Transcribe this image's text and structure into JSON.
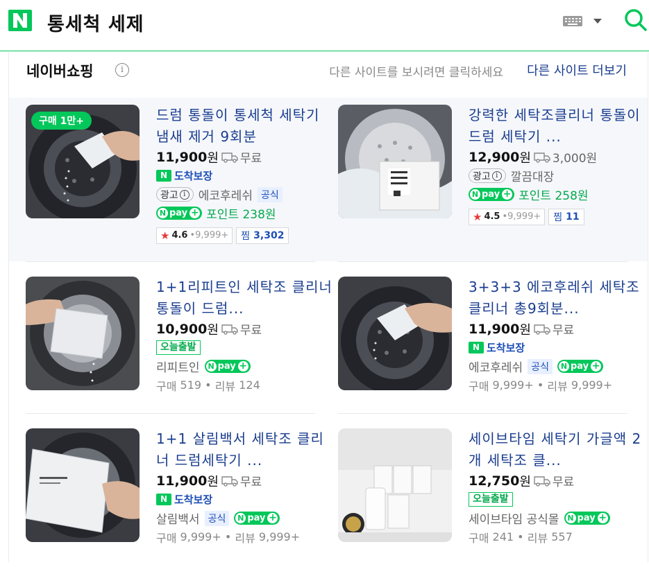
{
  "header": {
    "query": "통세척 세제"
  },
  "section": {
    "title": "네이버쇼핑",
    "other_hint": "다른 사이트를 보시려면 클릭하세요",
    "other_link": "다른 사이트 더보기"
  },
  "labels": {
    "won": "원",
    "ad": "광고",
    "official": "공식",
    "arrival": "도착보장",
    "today": "오늘출발",
    "npay": "pay",
    "zzim": "찜",
    "points_prefix": "포인트",
    "purchase": "구매",
    "review": "리뷰",
    "star": "★"
  },
  "products": [
    {
      "title": "드럼 통돌이 통세척 세탁기 냄새 제거 9회분",
      "price": "11,900",
      "shipping": "무료",
      "badge": "구매 1만+",
      "seller": "에코후레쉬",
      "points": "238원",
      "rating": "4.6",
      "rating_count": "9,999+",
      "zzim": "3,302"
    },
    {
      "title": "강력한 세탁조클리너 통돌이 드럼 세탁기 ...",
      "price": "12,900",
      "shipping": "3,000원",
      "seller": "깔끔대장",
      "points": "258원",
      "rating": "4.5",
      "rating_count": "9,999+",
      "zzim": "11"
    },
    {
      "title": "1+1리피트인 세탁조 클리너 통돌이 드럼...",
      "price": "10,900",
      "shipping": "무료",
      "seller": "리피트인",
      "purchases": "519",
      "reviews": "124"
    },
    {
      "title": "3+3+3 에코후레쉬 세탁조 클리너 총9회분...",
      "price": "11,900",
      "shipping": "무료",
      "seller": "에코후레쉬",
      "purchases": "9,999+",
      "reviews": "9,999+"
    },
    {
      "title": "1+1 살림백서 세탁조 클리너 드럼세탁기 ...",
      "price": "11,900",
      "shipping": "무료",
      "seller": "살림백서",
      "purchases": "9,999+",
      "reviews": "9,999+"
    },
    {
      "title": "세이브타임 세탁기 가글액 2개 세탁조 클...",
      "price": "12,750",
      "shipping": "무료",
      "seller": "세이브타임 공식몰",
      "purchases": "241",
      "reviews": "557"
    }
  ],
  "colors": {
    "brand": "#03c75a",
    "link": "#1a3d8f",
    "ad_band": "#f5f7fb"
  }
}
